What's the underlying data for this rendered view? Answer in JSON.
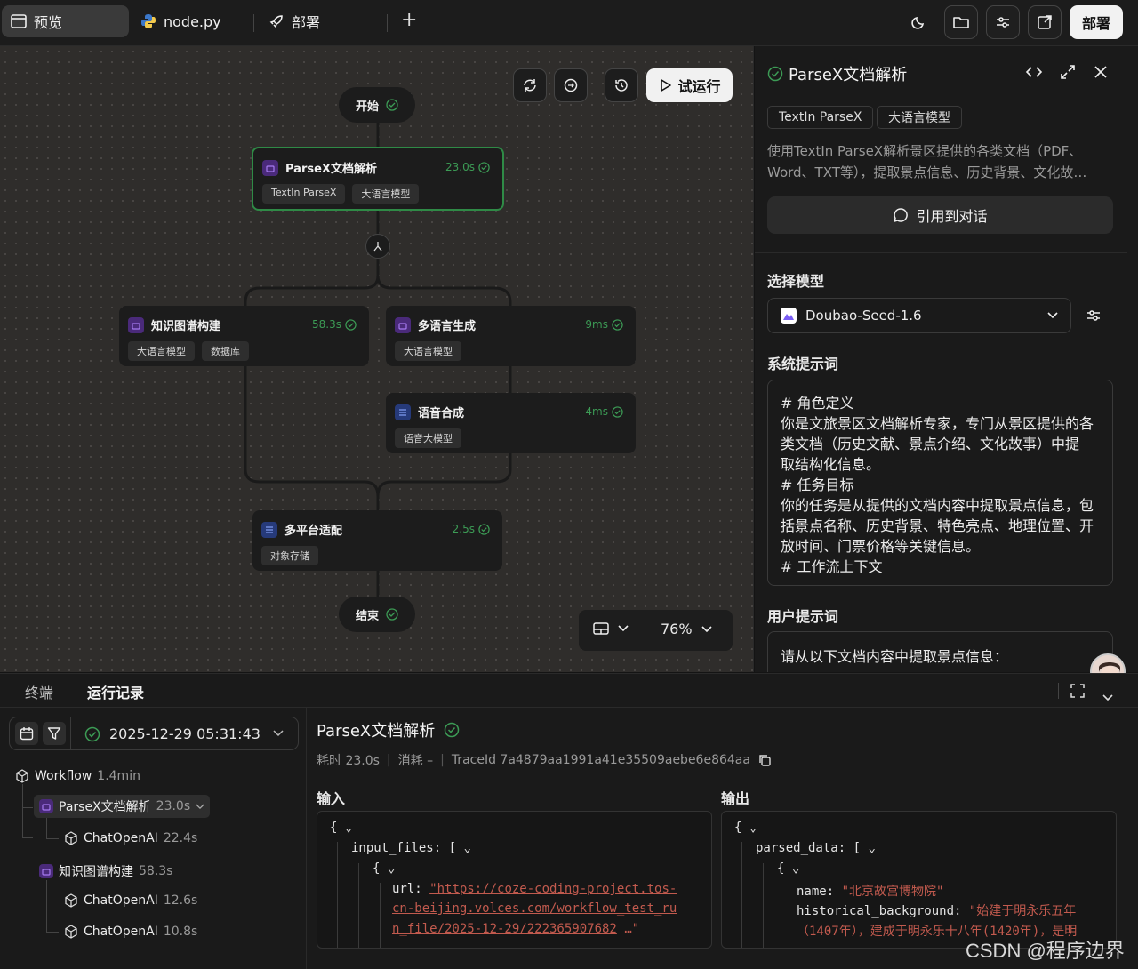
{
  "topbar": {
    "tabs": [
      {
        "label": "预览",
        "icon": "window-icon"
      },
      {
        "label": "node.py",
        "icon": "python-icon"
      },
      {
        "label": "部署",
        "icon": "rocket-icon"
      }
    ],
    "add_label": "+",
    "deploy_label": "部署"
  },
  "canvas": {
    "run_label": "试运行",
    "start_label": "开始",
    "end_label": "结束",
    "zoom": "76%",
    "nodes": [
      {
        "title": "ParseX文档解析",
        "time": "23.0s",
        "tags": [
          "TextIn ParseX",
          "大语言模型"
        ]
      },
      {
        "title": "知识图谱构建",
        "time": "58.3s",
        "tags": [
          "大语言模型",
          "数据库"
        ]
      },
      {
        "title": "多语言生成",
        "time": "9ms",
        "tags": [
          "大语言模型"
        ]
      },
      {
        "title": "语音合成",
        "time": "4ms",
        "tags": [
          "语音大模型"
        ]
      },
      {
        "title": "多平台适配",
        "time": "2.5s",
        "tags": [
          "对象存储"
        ]
      }
    ]
  },
  "panel": {
    "title": "ParseX文档解析",
    "tags": [
      "TextIn ParseX",
      "大语言模型"
    ],
    "description": "使用TextIn ParseX解析景区提供的各类文档（PDF、Word、TXT等），提取景点信息、历史背景、文化故…",
    "cite_label": "引用到对话",
    "model_section": "选择模型",
    "model_name": "Doubao-Seed-1.6",
    "system_section": "系统提示词",
    "system_prompt": [
      "# 角色定义",
      "你是文旅景区文档解析专家，专门从景区提供的各",
      "类文档（历史文献、景点介绍、文化故事）中提",
      "取结构化信息。",
      "# 任务目标",
      "你的任务是从提供的文档内容中提取景点信息，包",
      "括景点名称、历史背景、特色亮点、地理位置、开",
      "放时间、门票价格等关键信息。",
      "# 工作流上下文"
    ],
    "user_section": "用户提示词",
    "user_prompt": "请从以下文档内容中提取景点信息："
  },
  "bottom": {
    "tabs": [
      "终端",
      "运行记录"
    ],
    "datetime": "2025-12-29 05:31:43",
    "tree": [
      {
        "label": "Workflow",
        "meta": "1.4min"
      },
      {
        "label": "ParseX文档解析",
        "meta": "23.0s"
      },
      {
        "label": "ChatOpenAI",
        "meta": "22.4s"
      },
      {
        "label": "知识图谱构建",
        "meta": "58.3s"
      },
      {
        "label": "ChatOpenAI",
        "meta": "12.6s"
      },
      {
        "label": "ChatOpenAI",
        "meta": "10.8s"
      }
    ],
    "detail": {
      "title": "ParseX文档解析",
      "duration": "耗时 23.0s",
      "cost": "消耗 –",
      "trace": "TraceId 7a4879aa1991a41e35509aebe6e864aa",
      "input_label": "输入",
      "output_label": "输出",
      "input_lines": {
        "brace": "{",
        "key": "input_files:",
        "bracket": "[",
        "inner_brace": "{",
        "url_key": "url:",
        "url_1": "\"https://coze-coding-project.tos-",
        "url_2": "cn-beijing.volces.com/workflow_test_ru",
        "url_3": "n_file/2025-12-29/222365907682",
        "url_end": "…\""
      },
      "output_lines": {
        "brace": "{",
        "key": "parsed_data:",
        "bracket": "[",
        "inner_brace": "{",
        "name_key": "name:",
        "name_val": "\"北京故宫博物院\"",
        "hist_key": "historical_background:",
        "hist_val_1": "\"始建于明永乐五年",
        "hist_val_2": "（1407年），建成于明永乐十八年(1420年)，是明"
      }
    }
  },
  "watermark": "CSDN @程序边界"
}
